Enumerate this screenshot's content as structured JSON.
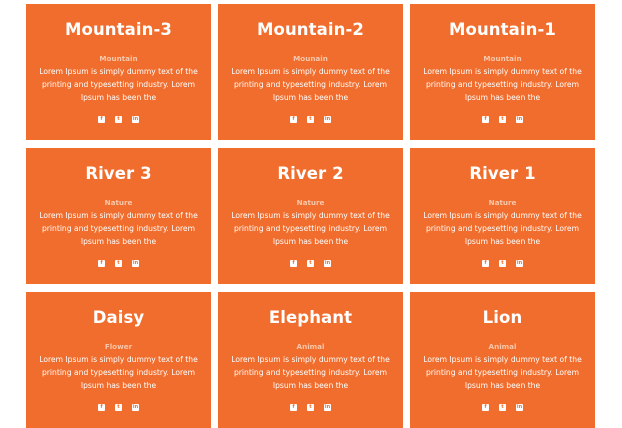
{
  "colors": {
    "card_bg": "#f06d2d",
    "category_text": "#f7c7ab",
    "page_bg": "#ffffff"
  },
  "cards": [
    {
      "title": "Mountain-3",
      "category": "Mountain",
      "description": "Lorem Ipsum is simply dummy text of the printing and typesetting industry. Lorem Ipsum has been the",
      "icons": [
        "facebook-icon",
        "twitter-icon",
        "linkedin-icon"
      ]
    },
    {
      "title": "Mountain-2",
      "category": "Mounain",
      "description": "Lorem Ipsum is simply dummy text of the printing and typesetting industry. Lorem Ipsum has been the",
      "icons": [
        "facebook-icon",
        "twitter-icon",
        "linkedin-icon"
      ]
    },
    {
      "title": "Mountain-1",
      "category": "Mountain",
      "description": "Lorem Ipsum is simply dummy text of the printing and typesetting industry. Lorem Ipsum has been the",
      "icons": [
        "facebook-icon",
        "twitter-icon",
        "linkedin-icon"
      ]
    },
    {
      "title": "River 3",
      "category": "Nature",
      "description": "Lorem Ipsum is simply dummy text of the printing and typesetting industry. Lorem Ipsum has been the",
      "icons": [
        "facebook-icon",
        "twitter-icon",
        "linkedin-icon"
      ]
    },
    {
      "title": "River 2",
      "category": "Nature",
      "description": "Lorem Ipsum is simply dummy text of the printing and typesetting industry. Lorem Ipsum has been the",
      "icons": [
        "facebook-icon",
        "twitter-icon",
        "linkedin-icon"
      ]
    },
    {
      "title": "River 1",
      "category": "Nature",
      "description": "Lorem Ipsum is simply dummy text of the printing and typesetting industry. Lorem Ipsum has been the",
      "icons": [
        "facebook-icon",
        "twitter-icon",
        "linkedin-icon"
      ]
    },
    {
      "title": "Daisy",
      "category": "Flower",
      "description": "Lorem Ipsum is simply dummy text of the printing and typesetting industry. Lorem Ipsum has been the",
      "icons": [
        "facebook-icon",
        "twitter-icon",
        "linkedin-icon"
      ]
    },
    {
      "title": "Elephant",
      "category": "Animal",
      "description": "Lorem Ipsum is simply dummy text of the printing and typesetting industry. Lorem Ipsum has been the",
      "icons": [
        "facebook-icon",
        "twitter-icon",
        "linkedin-icon"
      ]
    },
    {
      "title": "Lion",
      "category": "Animal",
      "description": "Lorem Ipsum is simply dummy text of the printing and typesetting industry. Lorem Ipsum has been the",
      "icons": [
        "facebook-icon",
        "twitter-icon",
        "linkedin-icon"
      ]
    }
  ]
}
